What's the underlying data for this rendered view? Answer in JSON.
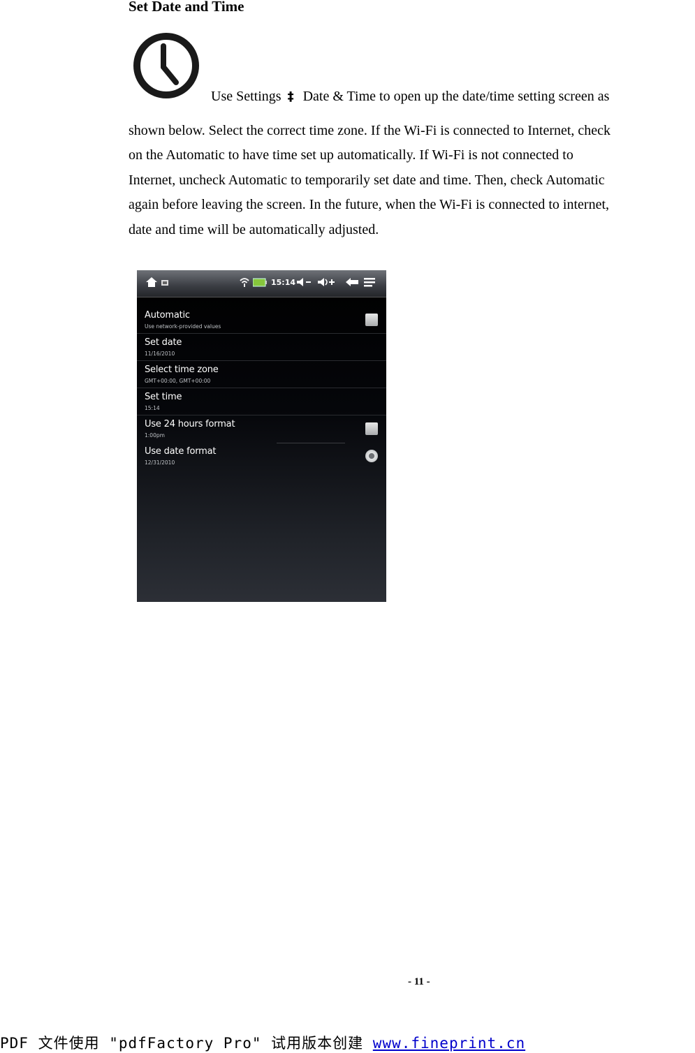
{
  "heading": "Set Date and Time",
  "intro": {
    "before_arrow": "Use Settings",
    "arrow": "‡",
    "after_arrow": "Date & Time to open up the date/time setting screen as"
  },
  "body_lines": [
    "shown below. Select the correct time zone. If the Wi-Fi is connected to Internet, check",
    "on the Automatic to have time set up automatically. If Wi-Fi is not connected to",
    "Internet, uncheck Automatic to temporarily set date and time. Then, check Automatic",
    "again before leaving the screen. In the future, when the Wi-Fi is connected to internet,",
    "date and time will be automatically adjusted."
  ],
  "screenshot": {
    "status_time": "15:14",
    "rows": [
      {
        "title": "Automatic",
        "subtitle": "Use network-provided values",
        "control": "checkbox"
      },
      {
        "title": "Set date",
        "subtitle": "11/16/2010",
        "control": "none"
      },
      {
        "title": "Select time zone",
        "subtitle": "GMT+00:00, GMT+00:00",
        "control": "none"
      },
      {
        "title": "Set time",
        "subtitle": "15:14",
        "control": "none"
      },
      {
        "title": "Use 24 hours format",
        "subtitle": "1:00pm",
        "control": "checkbox"
      },
      {
        "title": "Use date format",
        "subtitle": "12/31/2010",
        "control": "radio"
      }
    ],
    "icons": [
      "home-icon",
      "notification-icon",
      "wifi-icon",
      "battery-icon",
      "volume-down-icon",
      "volume-up-icon",
      "back-icon",
      "menu-icon"
    ]
  },
  "page_number": "- 11 -",
  "footer": {
    "text": "PDF 文件使用 \"pdfFactory Pro\" 试用版本创建 ",
    "link": "www.fineprint.cn"
  },
  "colors": {
    "link": "#0000cc"
  }
}
